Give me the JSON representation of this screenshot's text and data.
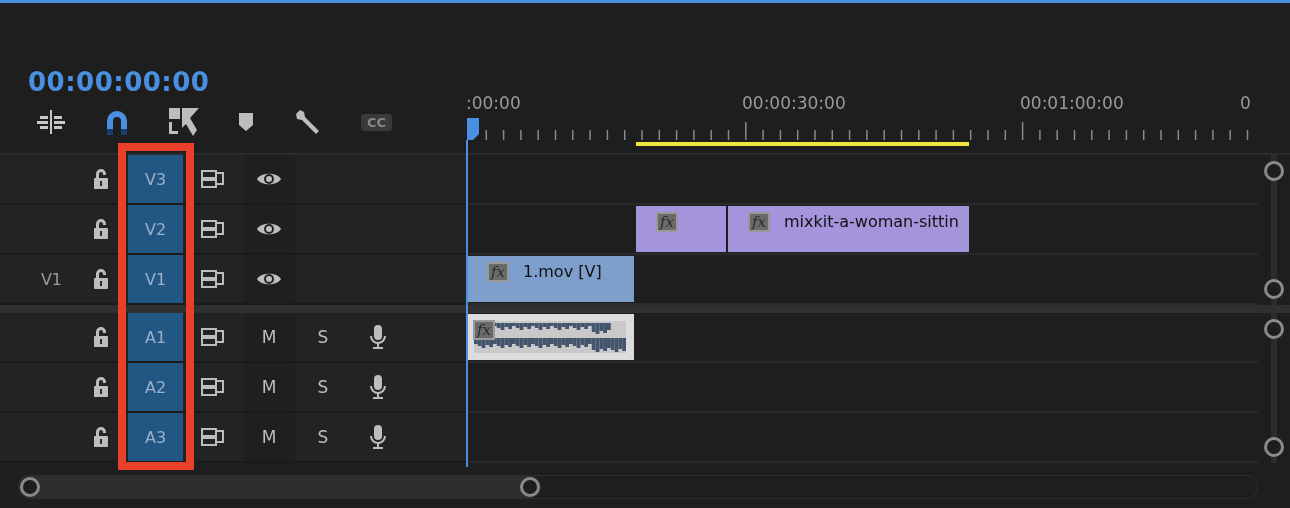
{
  "timecode": "00:00:00:00",
  "toolbar": {
    "snap": true,
    "captions": "CC"
  },
  "ruler": {
    "labels": [
      ":00:00",
      "00:00:30:00",
      "00:01:00:00",
      "0"
    ]
  },
  "video_tracks": [
    {
      "name": "V3",
      "targeted": true
    },
    {
      "name": "V2",
      "targeted": true,
      "clips": [
        {
          "badge": "fx",
          "color": "#a394dc"
        },
        {
          "label": "mixkit-a-woman-sittin",
          "badge": "fx",
          "color": "#a394dc"
        }
      ]
    },
    {
      "name": "V1",
      "source_patch": "V1",
      "targeted": true,
      "clips": [
        {
          "label": "1.mov [V]",
          "badge": "fx",
          "color": "#7e9fcc"
        }
      ]
    }
  ],
  "audio_tracks": [
    {
      "name": "A1",
      "targeted": true,
      "mute": "M",
      "solo": "S",
      "clips": [
        {
          "badge": "fx",
          "color": "#dcdcdc"
        }
      ]
    },
    {
      "name": "A2",
      "targeted": true,
      "mute": "M",
      "solo": "S"
    },
    {
      "name": "A3",
      "targeted": true,
      "mute": "M",
      "solo": "S"
    }
  ]
}
